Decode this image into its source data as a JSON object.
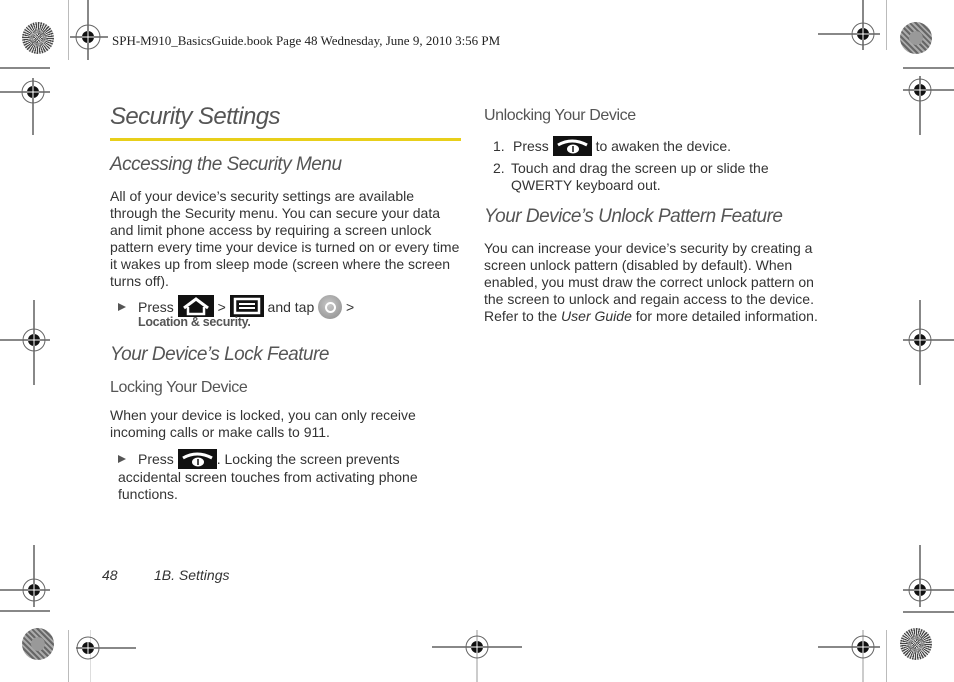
{
  "header": {
    "print_info": "SPH-M910_BasicsGuide.book  Page 48  Wednesday, June 9, 2010  3:56 PM"
  },
  "page": {
    "title": "Security Settings",
    "accent_color": "#e8cf1a"
  },
  "left_column": {
    "section1": {
      "heading": "Accessing the Security Menu",
      "paragraph": "All of your device’s security settings are available through the Security menu. You can secure your data and limit phone access by requiring a screen unlock pattern every time your device is turned on or every time it wakes up from sleep mode (screen where the screen turns off).",
      "step": {
        "press": "Press",
        "icon1": "home-key-icon",
        "sep1": ">",
        "icon2": "menu-key-icon",
        "and_tap": "and tap",
        "icon3": "settings-icon",
        "sep2": ">",
        "destination": "Location & security."
      }
    },
    "section2": {
      "heading": "Your Device’s Lock Feature",
      "subheading": "Locking Your Device",
      "paragraph": "When your device is locked, you can only receive incoming calls or make calls to 911.",
      "step": {
        "press": "Press",
        "icon": "end-power-key-icon",
        "text": ". Locking the screen prevents accidental screen touches from activating phone functions."
      }
    }
  },
  "right_column": {
    "section1": {
      "subheading": "Unlocking Your Device",
      "steps": [
        {
          "num": "1.",
          "before": "Press",
          "icon": "end-power-key-icon",
          "after": "to awaken the device."
        },
        {
          "num": "2.",
          "text": "Touch and drag the screen up or slide the QWERTY keyboard out."
        }
      ]
    },
    "section2": {
      "heading": "Your Device’s Unlock Pattern Feature",
      "paragraph_before": "You can increase your device’s security by creating a screen unlock pattern (disabled by default). When enabled, you must draw the correct unlock pattern on the screen to unlock and regain access to the device. Refer to the ",
      "paragraph_italic": "User Guide",
      "paragraph_after": " for more detailed information."
    }
  },
  "footer": {
    "page_number": "48",
    "section": "1B. Settings"
  }
}
